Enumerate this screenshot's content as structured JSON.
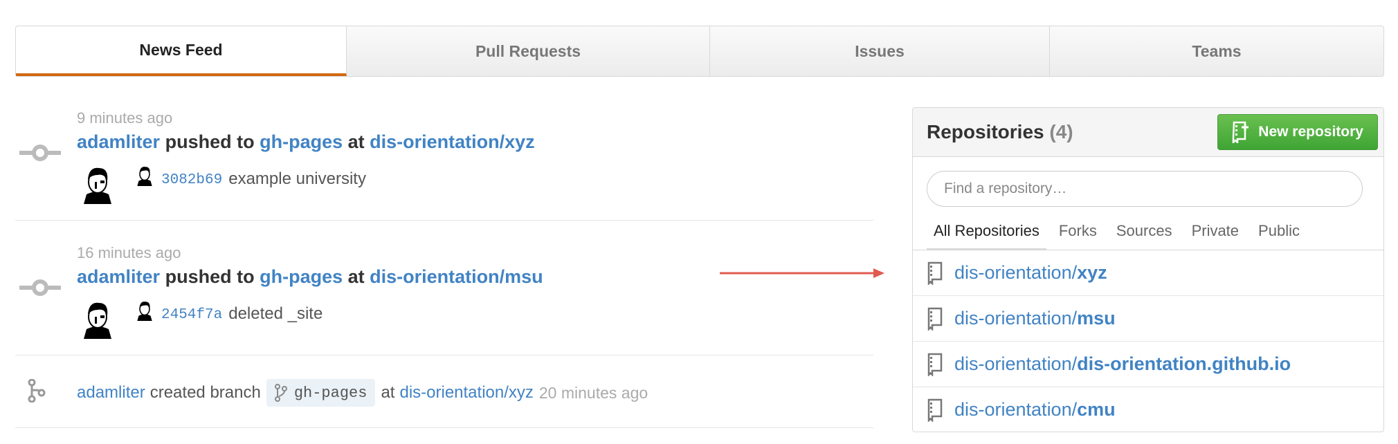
{
  "tabs": [
    {
      "label": "News Feed",
      "active": true
    },
    {
      "label": "Pull Requests",
      "active": false
    },
    {
      "label": "Issues",
      "active": false
    },
    {
      "label": "Teams",
      "active": false
    }
  ],
  "feed": [
    {
      "type": "push",
      "time": "9 minutes ago",
      "user": "adamliter",
      "verb": "pushed to",
      "branch": "gh-pages",
      "at": "at",
      "repo": "dis-orientation/xyz",
      "sha": "3082b69",
      "message": "example university"
    },
    {
      "type": "push",
      "time": "16 minutes ago",
      "user": "adamliter",
      "verb": "pushed to",
      "branch": "gh-pages",
      "at": "at",
      "repo": "dis-orientation/msu",
      "sha": "2454f7a",
      "message": "deleted _site"
    },
    {
      "type": "branch",
      "user": "adamliter",
      "verb": "created branch",
      "branch": "gh-pages",
      "at": "at",
      "repo": "dis-orientation/xyz",
      "time": "20 minutes ago"
    }
  ],
  "repositories": {
    "title": "Repositories",
    "count": "(4)",
    "new_button": "New repository",
    "search_placeholder": "Find a repository…",
    "filters": [
      "All Repositories",
      "Forks",
      "Sources",
      "Private",
      "Public"
    ],
    "items": [
      {
        "owner": "dis-orientation/",
        "name": "xyz"
      },
      {
        "owner": "dis-orientation/",
        "name": "msu"
      },
      {
        "owner": "dis-orientation/",
        "name": "dis-orientation.github.io"
      },
      {
        "owner": "dis-orientation/",
        "name": "cmu"
      }
    ]
  },
  "colors": {
    "link": "#4183c4",
    "active_tab_underline": "#d26911",
    "new_button": "#4cb043",
    "annotation_arrow": "#e05a4f"
  },
  "icons": {
    "push": "git-commit-icon",
    "branch": "git-branch-icon",
    "repo": "repo-icon",
    "new_repo": "repo-create-icon"
  }
}
